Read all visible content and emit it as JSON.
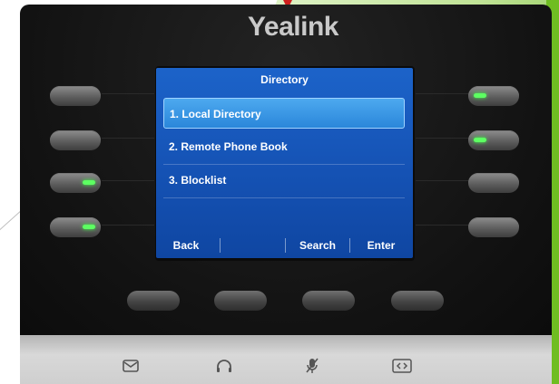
{
  "brand": "Yealink",
  "screen": {
    "title": "Directory",
    "items": [
      {
        "label": "1. Local Directory",
        "selected": true
      },
      {
        "label": "2. Remote Phone Book",
        "selected": false
      },
      {
        "label": "3. Blocklist",
        "selected": false
      }
    ],
    "softkeys": [
      "Back",
      "",
      "Search",
      "Enter"
    ]
  },
  "line_keys": {
    "left": [
      {
        "led": "off"
      },
      {
        "led": "off"
      },
      {
        "led": "green"
      },
      {
        "led": "green"
      }
    ],
    "right": [
      {
        "led": "green"
      },
      {
        "led": "green"
      },
      {
        "led": "off"
      },
      {
        "led": "off"
      }
    ]
  },
  "bottom_keys_count": 4,
  "panel_icons": [
    "message-icon",
    "headset-icon",
    "mute-icon",
    "transfer-icon"
  ],
  "colors": {
    "screen_blue": "#1552b4",
    "selection": "#2a86da",
    "led_green": "#5dff62",
    "body": "#141414",
    "panel": "#d0d0d0"
  }
}
